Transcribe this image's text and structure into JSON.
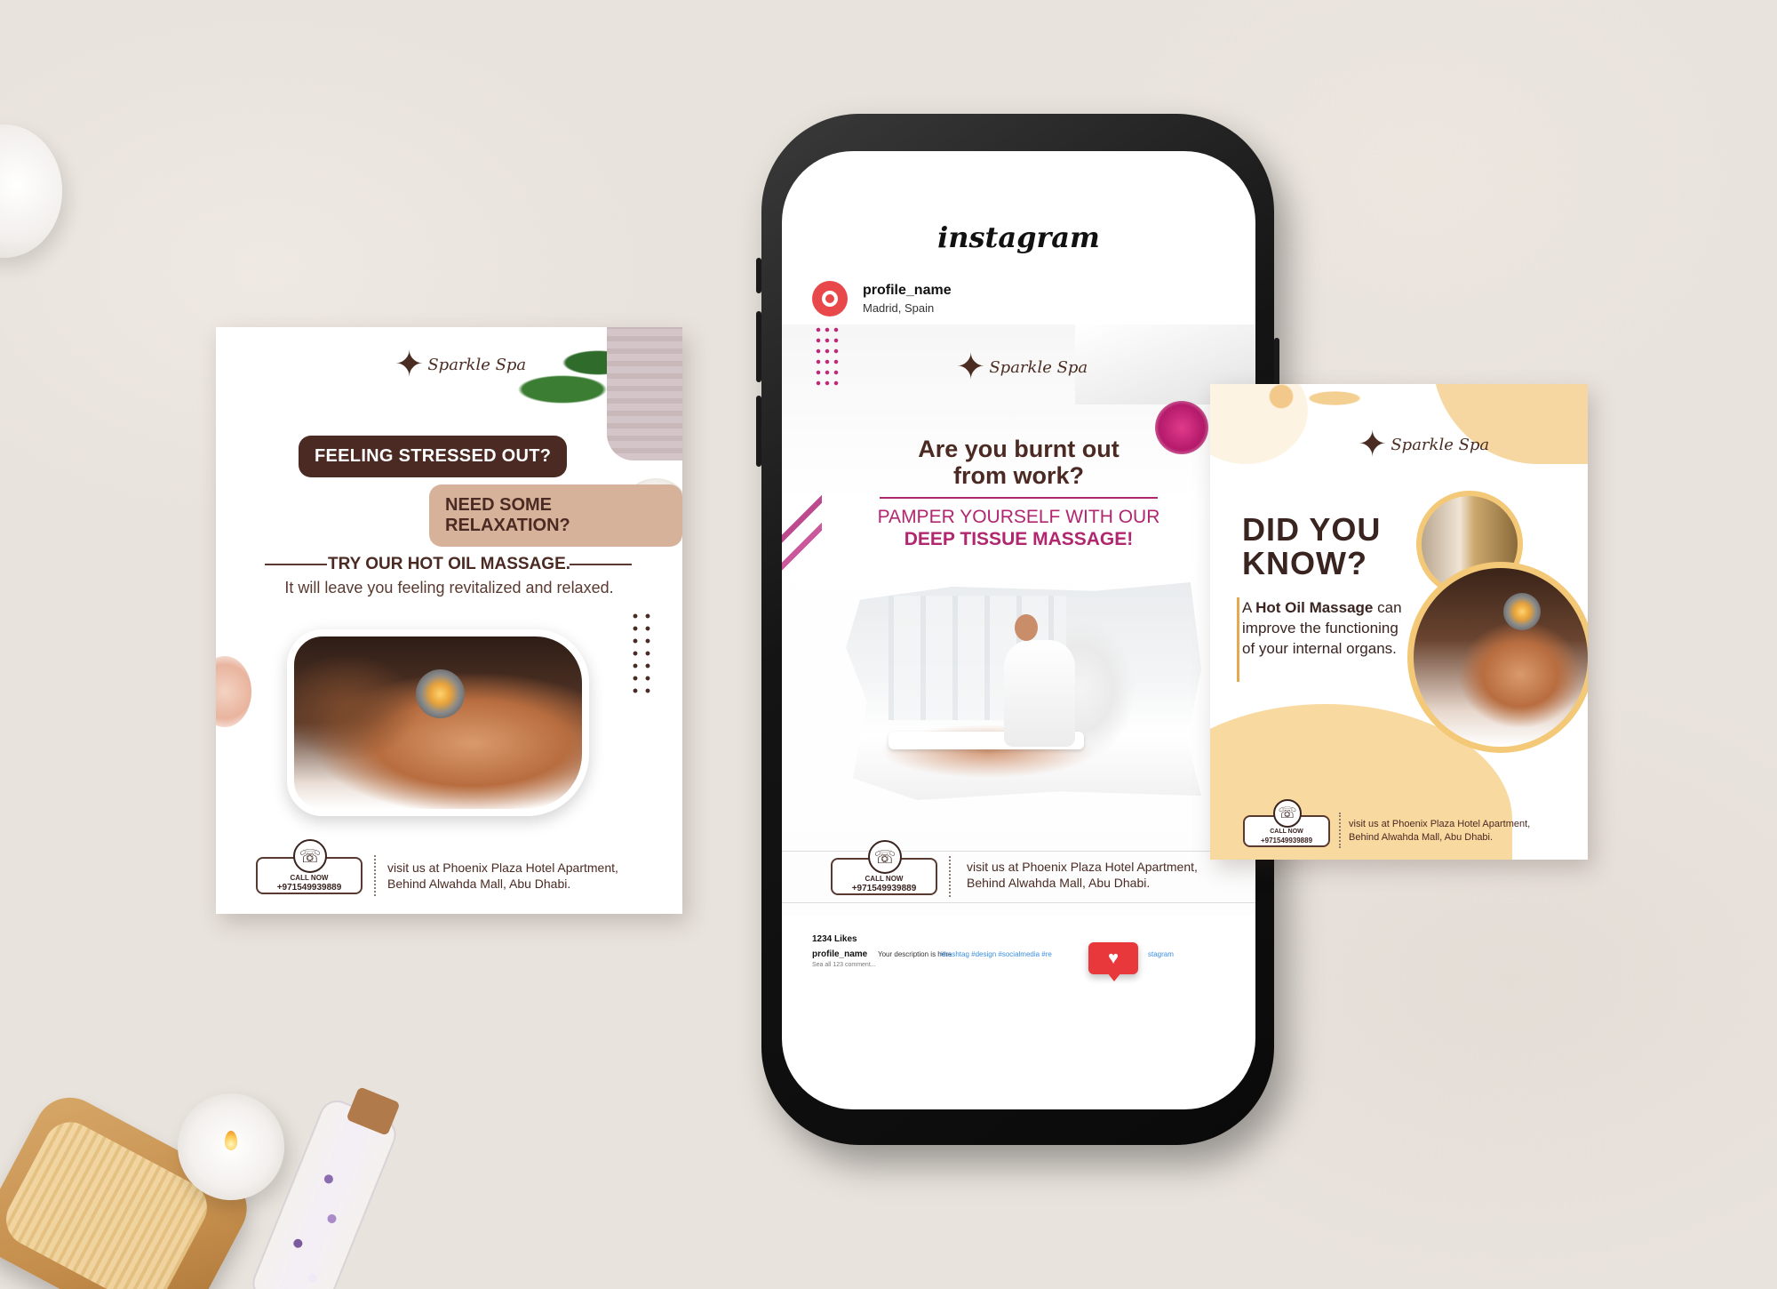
{
  "colors": {
    "background": "#e9e3dd",
    "brand_brown": "#4a2a22",
    "accent_magenta": "#b0276f",
    "accent_gold": "#f3c877",
    "instagram_red": "#e8383b",
    "hashtag_blue": "#3a8ee0"
  },
  "brand": {
    "logo_text": "Sparkle Spa",
    "logo_icon": "sparkle-star-icon"
  },
  "left_card": {
    "bubble_question_1": "FEELING STRESSED OUT?",
    "bubble_question_2": "NEED SOME RELAXATION?",
    "headline": "TRY OUR HOT OIL MASSAGE.",
    "subline": "It will leave you feeling revitalized and relaxed.",
    "call_label": "CALL NOW",
    "call_number": "+971549939889",
    "address_line_1": "visit us at Phoenix Plaza Hotel Apartment,",
    "address_line_2": "Behind Alwahda Mall, Abu Dhabi."
  },
  "instagram": {
    "app_title": "instagram",
    "profile_name": "profile_name",
    "location": "Madrid, Spain",
    "post": {
      "headline_line_1": "Are you burnt out",
      "headline_line_2": "from work?",
      "pamper_line": "PAMPER YOURSELF WITH OUR",
      "service_line": "DEEP TISSUE MASSAGE!",
      "call_label": "CALL NOW",
      "call_number": "+971549939889",
      "address_line_1": "visit us at Phoenix Plaza Hotel Apartment,",
      "address_line_2": "Behind Alwahda Mall, Abu Dhabi."
    },
    "likes": "1234 Likes",
    "caption_name": "profile_name",
    "caption_description": "Your description is here",
    "caption_hashtags": "#hashtag #design #socialmedia #re",
    "caption_hashtags_tail": "stagram",
    "comments_link": "Sea all 123 comment...",
    "like_icon": "heart-icon"
  },
  "right_card": {
    "heading_line_1": "DID YOU",
    "heading_line_2": "KNOW?",
    "body_prefix": "A ",
    "body_bold": "Hot Oil Massage",
    "body_rest": "can improve the functioning of your internal organs.",
    "call_label": "CALL NOW",
    "call_number": "+971549939889",
    "address_line_1": "visit us at Phoenix Plaza Hotel Apartment,",
    "address_line_2": "Behind Alwahda Mall, Abu Dhabi."
  }
}
